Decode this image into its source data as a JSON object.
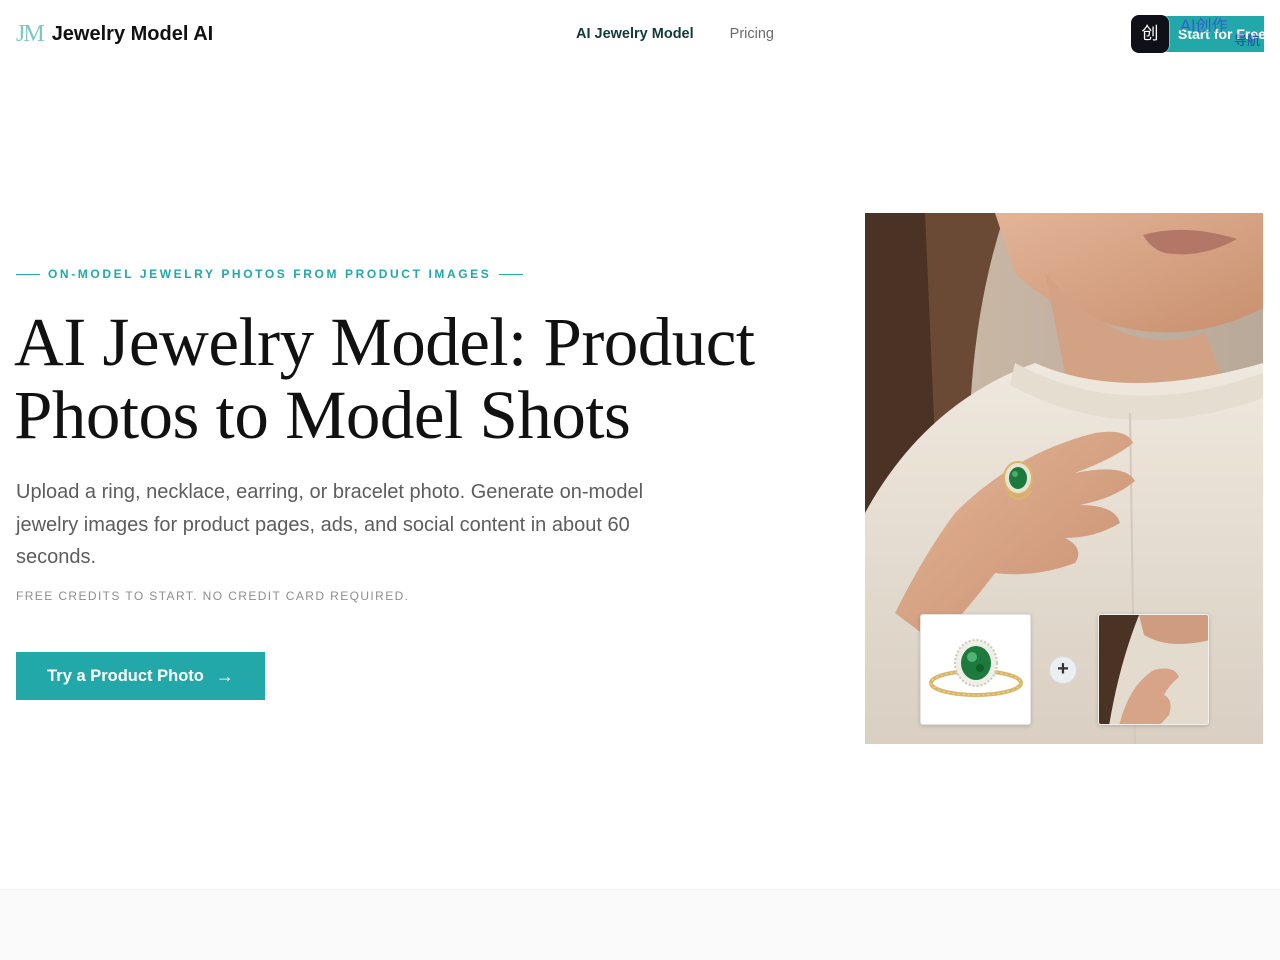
{
  "header": {
    "logo_mark": "JM",
    "brand_name": "Jewelry Model AI",
    "nav": [
      {
        "label": "AI Jewelry Model",
        "active": true
      },
      {
        "label": "Pricing",
        "active": false
      }
    ],
    "cta_label": "Start for Free",
    "extension_badge_glyph": "创",
    "extension_label": "AI创作",
    "extension_sublabel": "导航"
  },
  "hero": {
    "eyebrow": "ON-MODEL JEWELRY PHOTOS FROM PRODUCT IMAGES",
    "title_line1": "AI Jewelry Model: Product",
    "title_line2": "Photos to Model Shots",
    "subtitle": "Upload a ring, necklace, earring, or bracelet photo. Generate on-model jewelry images for product pages, ads, and social content in about 60 seconds.",
    "note": "FREE CREDITS TO START. NO CREDIT CARD REQUIRED.",
    "cta_label": "Try a Product Photo",
    "cta_icon": "arrow-right-icon",
    "plus_glyph": "+"
  },
  "colors": {
    "accent": "#22a8a8",
    "text": "#111111",
    "muted": "#5d5d5d",
    "sweater": "#ece5db",
    "skin": "#d8a88a",
    "emerald": "#1c7a3c",
    "gold": "#d9b56a"
  }
}
